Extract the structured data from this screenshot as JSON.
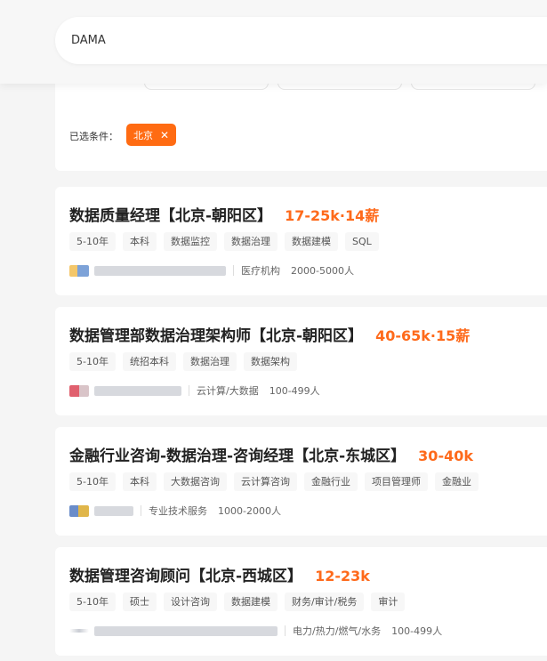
{
  "search": {
    "value": "DAMA"
  },
  "filters": {
    "selected_label": "已选条件：",
    "chips": [
      {
        "label": "北京",
        "remove_icon": "close-icon"
      }
    ]
  },
  "jobs": [
    {
      "title": "数据质量经理【北京-朝阳区】",
      "salary": "17-25k·14薪",
      "tags": [
        "5-10年",
        "本科",
        "数据监控",
        "数据治理",
        "数据建模",
        "SQL"
      ],
      "company_name_visible": false,
      "industry": "医疗机构",
      "size": "2000-5000人"
    },
    {
      "title": "数据管理部数据治理架构师【北京-朝阳区】",
      "salary": "40-65k·15薪",
      "tags": [
        "5-10年",
        "统招本科",
        "数据治理",
        "数据架构"
      ],
      "company_name_visible": false,
      "industry": "云计算/大数据",
      "size": "100-499人"
    },
    {
      "title": "金融行业咨询-数据治理-咨询经理【北京-东城区】",
      "salary": "30-40k",
      "tags": [
        "5-10年",
        "本科",
        "大数据咨询",
        "云计算咨询",
        "金融行业",
        "项目管理师",
        "金融业"
      ],
      "company_name_visible": false,
      "industry": "专业技术服务",
      "size": "1000-2000人"
    },
    {
      "title": "数据管理咨询顾问【北京-西城区】",
      "salary": "12-23k",
      "tags": [
        "5-10年",
        "硕士",
        "设计咨询",
        "数据建模",
        "财务/审计/税务",
        "审计"
      ],
      "company_name_visible": false,
      "industry": "电力/热力/燃气/水务",
      "size": "100-499人"
    }
  ],
  "colors": {
    "accent": "#fe6a1b",
    "chip_bg": "#ff6b12",
    "page_bg": "#f5f5f5"
  }
}
